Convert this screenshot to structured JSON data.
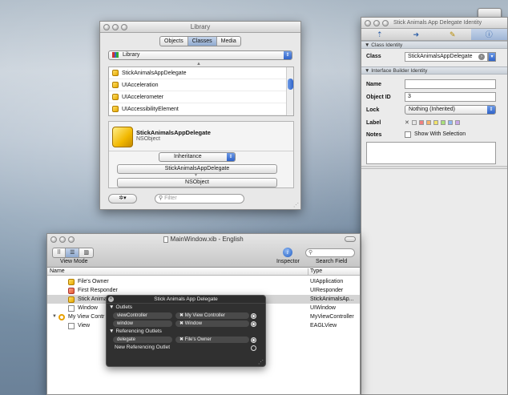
{
  "library": {
    "title": "Library",
    "tabs": [
      "Objects",
      "Classes",
      "Media"
    ],
    "active_tab": "Classes",
    "group_selector": "Library",
    "items": [
      "StickAnimalsAppDelegate",
      "UIAcceleration",
      "UIAccelerometer",
      "UIAccessibilityElement"
    ],
    "detail": {
      "name": "StickAnimalsAppDelegate",
      "superclass": "NSObject",
      "mode": "Inheritance",
      "hierarchy": [
        "StickAnimalsAppDelegate",
        "NSObject"
      ]
    },
    "filter_placeholder": "Filter"
  },
  "inspector": {
    "title": "Stick Animals App Delegate Identity",
    "class_section": "Class Identity",
    "class_label": "Class",
    "class_value": "StickAnimalsAppDelegate",
    "ib_section": "Interface Builder Identity",
    "name_label": "Name",
    "name_value": "",
    "objectid_label": "Object ID",
    "objectid_value": "3",
    "lock_label": "Lock",
    "lock_value": "Nothing (Inherited)",
    "label_label": "Label",
    "label_colors": [
      "#e8e8e8",
      "#f08080",
      "#f7b36b",
      "#f2e36b",
      "#a9e07a",
      "#8fb8f2",
      "#c9a6e8",
      "#cccccc"
    ],
    "notes_label": "Notes",
    "notes_checkbox": "Show With Selection"
  },
  "xib": {
    "title": "MainWindow.xib - English",
    "view_mode_label": "View Mode",
    "inspector_label": "Inspector",
    "search_label": "Search Field",
    "col_name": "Name",
    "col_type": "Type",
    "rows": [
      {
        "name": "File's Owner",
        "type": "UIApplication"
      },
      {
        "name": "First Responder",
        "type": "UIResponder"
      },
      {
        "name": "Stick Animals",
        "type": "StickAnimalsAp..."
      },
      {
        "name": "Window",
        "type": "UIWindow"
      },
      {
        "name": "My View Contr",
        "type": "MyViewController"
      },
      {
        "name": "View",
        "type": "EAGLView"
      }
    ]
  },
  "hud": {
    "title": "Stick Animals App Delegate",
    "outlets_header": "Outlets",
    "outlets": [
      {
        "name": "viewController",
        "target": "My View Controller"
      },
      {
        "name": "window",
        "target": "Window"
      }
    ],
    "ref_header": "Referencing Outlets",
    "ref_outlets": [
      {
        "name": "delegate",
        "target": "File's Owner"
      }
    ],
    "new_ref": "New Referencing Outlet"
  }
}
